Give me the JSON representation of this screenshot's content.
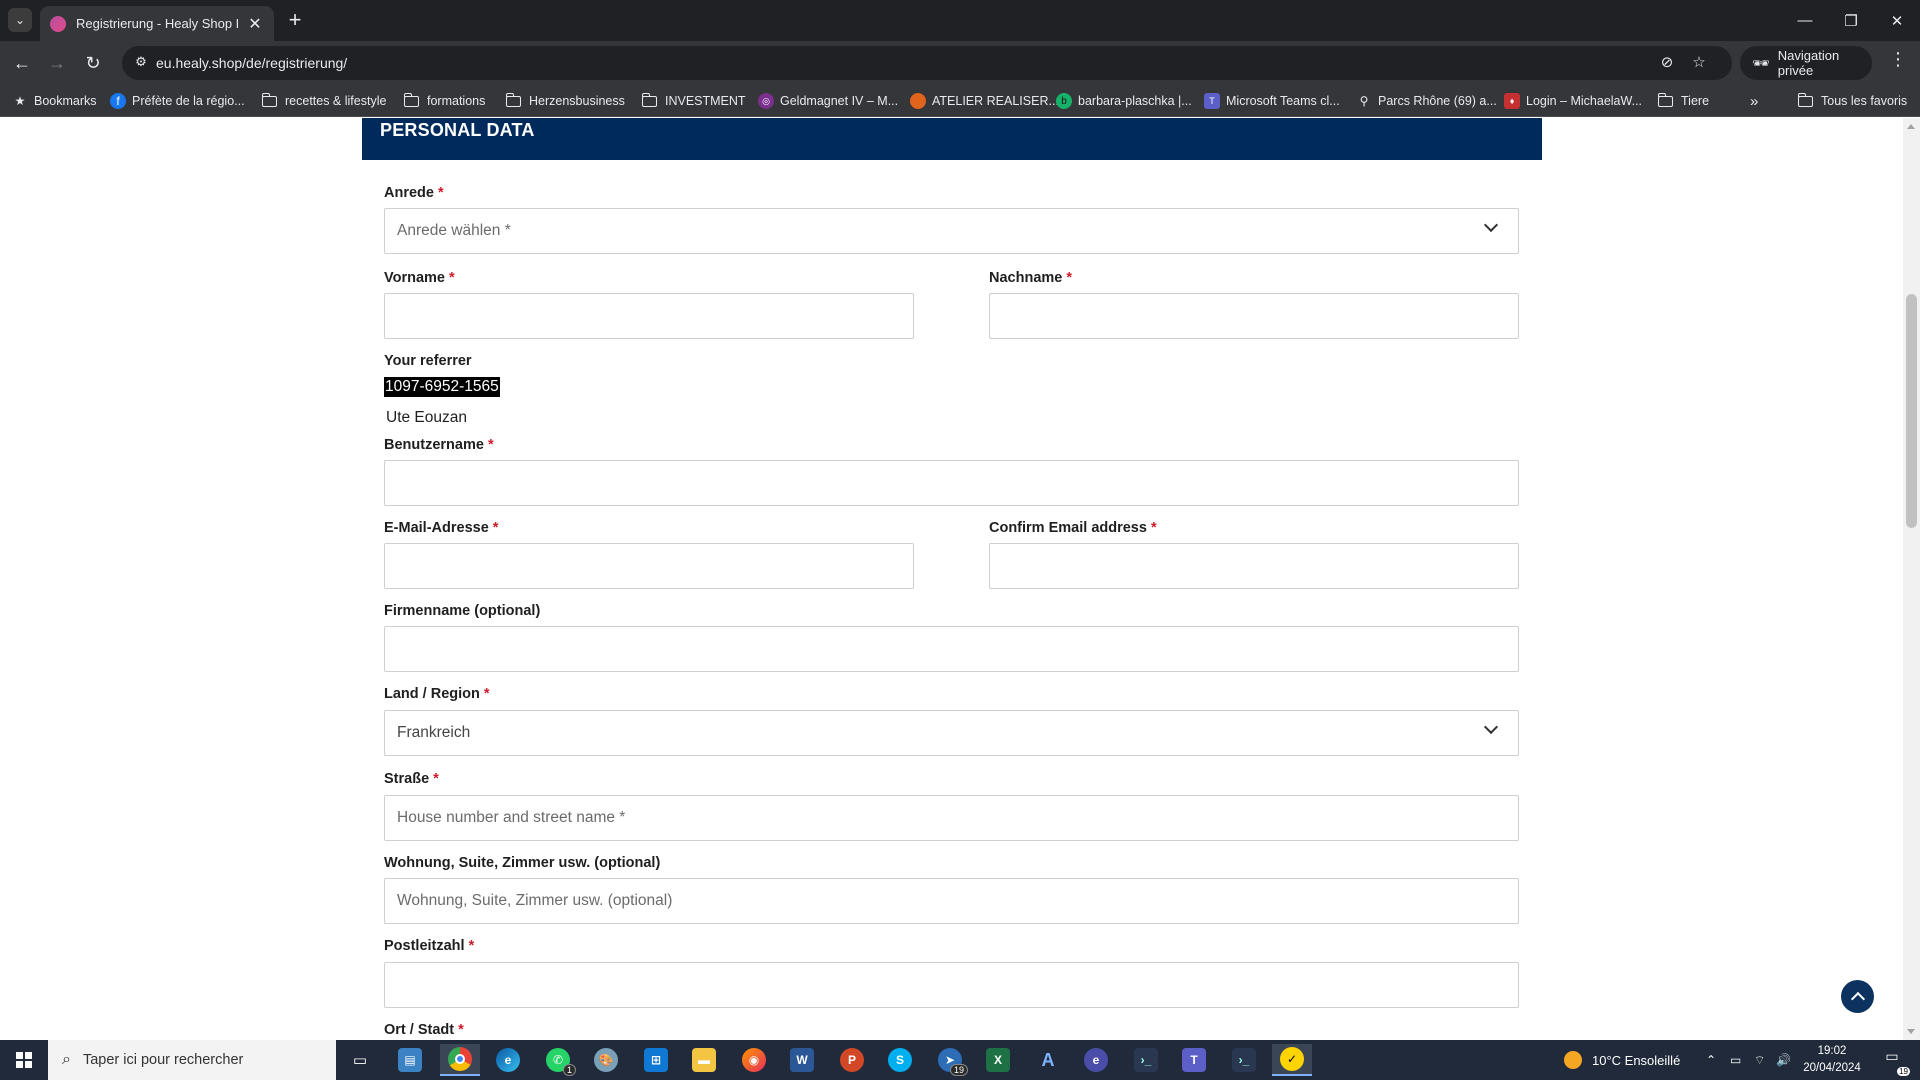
{
  "browser": {
    "tab_title": "Registrierung - Healy Shop Eu",
    "url": "eu.healy.shop/de/registrierung/",
    "incognito_label": "Navigation privée",
    "bookmarks": [
      {
        "label": "Bookmarks",
        "icon": "star-icon"
      },
      {
        "label": "Préfète de la régio...",
        "icon": "facebook-icon"
      },
      {
        "label": "recettes & lifestyle",
        "icon": "folder-icon"
      },
      {
        "label": "formations",
        "icon": "folder-icon"
      },
      {
        "label": "Herzensbusiness",
        "icon": "folder-icon"
      },
      {
        "label": "INVESTMENT",
        "icon": "folder-icon"
      },
      {
        "label": "Geldmagnet IV – M...",
        "icon": "site-icon"
      },
      {
        "label": "ATELIER REALISER...",
        "icon": "site-icon"
      },
      {
        "label": "barbara-plaschka |...",
        "icon": "site-icon"
      },
      {
        "label": "Microsoft Teams cl...",
        "icon": "teams-icon"
      },
      {
        "label": "Parcs Rhône (69) a...",
        "icon": "map-pin-icon"
      },
      {
        "label": "Login – MichaelaW...",
        "icon": "site-icon"
      },
      {
        "label": "Tiere",
        "icon": "folder-icon"
      }
    ],
    "all_bookmarks_label": "Tous les favoris"
  },
  "form": {
    "section_title": "PERSONAL DATA",
    "required_mark": "*",
    "anrede": {
      "label": "Anrede",
      "placeholder": "Anrede wählen *"
    },
    "vorname": {
      "label": "Vorname",
      "value": ""
    },
    "nachname": {
      "label": "Nachname",
      "value": ""
    },
    "referrer": {
      "label": "Your referrer",
      "number": "1097-6952-1565",
      "name": "Ute Eouzan"
    },
    "benutzername": {
      "label": "Benutzername",
      "value": ""
    },
    "email": {
      "label": "E-Mail-Adresse",
      "value": ""
    },
    "confirm_email": {
      "label": "Confirm Email address",
      "value": ""
    },
    "firmenname": {
      "label": "Firmenname (optional)",
      "value": ""
    },
    "land": {
      "label": "Land / Region",
      "value": "Frankreich"
    },
    "strasse": {
      "label": "Straße",
      "placeholder": "House number and street name *"
    },
    "wohnung": {
      "label": "Wohnung, Suite, Zimmer usw. (optional)",
      "placeholder": "Wohnung, Suite, Zimmer usw. (optional)"
    },
    "postleitzahl": {
      "label": "Postleitzahl",
      "value": ""
    },
    "ort": {
      "label": "Ort / Stadt"
    }
  },
  "taskbar": {
    "search_placeholder": "Taper ici pour rechercher",
    "weather": "10°C  Ensoleillé",
    "time": "19:02",
    "date": "20/04/2024",
    "whatsapp_badge": "1",
    "app_badge": "19",
    "notif_badge": "19"
  }
}
